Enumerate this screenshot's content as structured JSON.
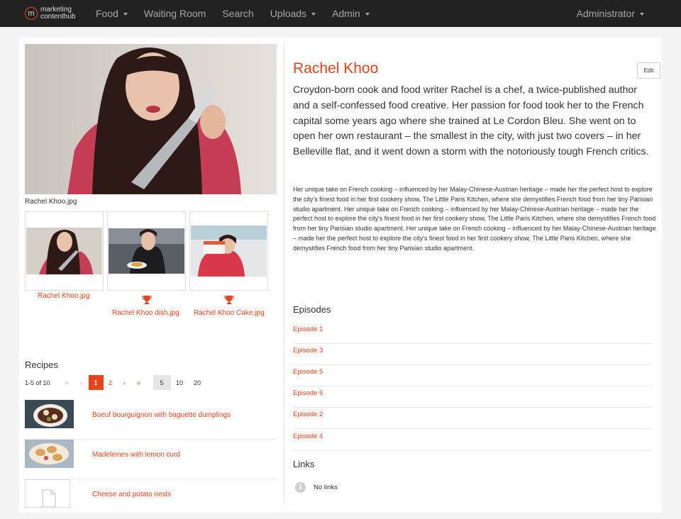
{
  "nav": {
    "brand_line1": "marketing",
    "brand_line2": "contenthub",
    "brand_mark": "m",
    "items": [
      {
        "label": "Food",
        "dropdown": true
      },
      {
        "label": "Waiting Room",
        "dropdown": false
      },
      {
        "label": "Search",
        "dropdown": false
      },
      {
        "label": "Uploads",
        "dropdown": true
      },
      {
        "label": "Admin",
        "dropdown": true
      }
    ],
    "user": "Administrator"
  },
  "images": {
    "main_caption": "Rachel Khoo.jpg",
    "thumbs": [
      {
        "label": "Rachel Khoo.jpg",
        "trophy": false
      },
      {
        "label": "Rachel Khoo dish.jpg",
        "trophy": true
      },
      {
        "label": "Rachel Khoo Cake.jpg",
        "trophy": true
      }
    ]
  },
  "recipes": {
    "title": "Recipes",
    "count": "1-5 of 10",
    "pager": {
      "first": "«",
      "prev": "‹",
      "pages": [
        "1",
        "2"
      ],
      "current": "1",
      "next": "›",
      "last": "»"
    },
    "page_sizes": [
      "5",
      "10",
      "20"
    ],
    "page_size_selected": "5",
    "items": [
      {
        "title": "Boeuf bourguignon with baguette dumplings"
      },
      {
        "title": "Madeleines with lemon curd"
      },
      {
        "title": "Cheese and potato nests"
      }
    ]
  },
  "person": {
    "name": "Rachel Khoo",
    "edit_label": "Edit",
    "lead": "Croydon-born cook and food writer Rachel is a chef, a twice-published author and a self-confessed food creative. Her passion for food took her to the French capital some years ago where she trained at Le Cordon Bleu. She went on to open her own restaurant – the smallest in the city, with just two covers – in her Belleville flat, and it went down a storm with the notoriously tough French critics.",
    "body": "Her unique take on French cooking – influenced by her Malay-Chinese-Austrian heritage – made her the perfect host to explore the city's finest food in her first cookery show, The Little Paris Kitchen, where she demystifies French food from her tiny Parisian studio apartment. Her unique take on French cooking – influenced by her Malay-Chinese-Austrian heritage – made her the perfect host to explore the city's finest food in her first cookery show, The Little Paris Kitchen, where she demystifies French food from her tiny Parisian studio apartment. Her unique take on French cooking – influenced by her Malay-Chinese-Austrian heritage – made her the perfect host to explore the city's finest food in her first cookery show, The Little Paris Kitchen, where she demystifies French food from her tiny Parisian studio apartment."
  },
  "episodes": {
    "title": "Episodes",
    "items": [
      "Episode 1",
      "Episode 3",
      "Episode 5",
      "Episode 6",
      "Episode 2",
      "Episode 4"
    ]
  },
  "links": {
    "title": "Links",
    "empty_text": "No links",
    "icon_glyph": "i"
  },
  "colors": {
    "accent": "#e8431e",
    "navbar": "#222222"
  }
}
